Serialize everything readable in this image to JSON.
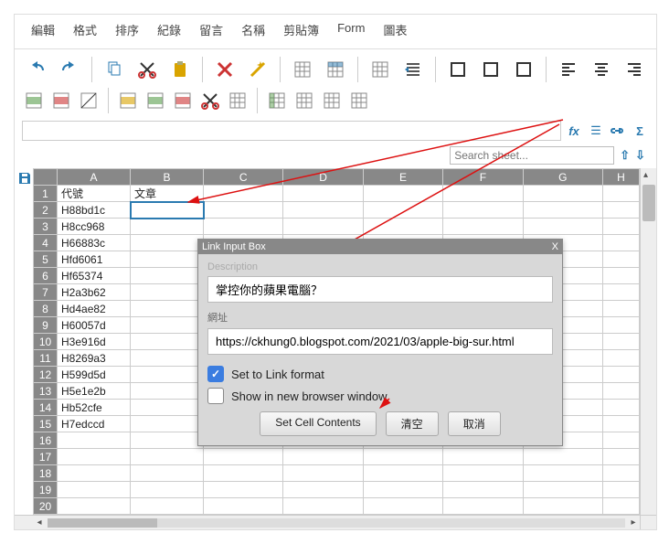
{
  "menubar": [
    "編輯",
    "格式",
    "排序",
    "紀錄",
    "留言",
    "名稱",
    "剪貼簿",
    "Form",
    "圖表"
  ],
  "toolbar": {
    "row1_icons": [
      "undo",
      "redo",
      "sep",
      "copy",
      "cut",
      "paste",
      "sep",
      "delete",
      "magic",
      "sep",
      "grid-a",
      "grid-b",
      "sep",
      "grid-c",
      "indent",
      "sep",
      "border-a",
      "border-b",
      "border-c",
      "sep",
      "align-l",
      "align-c",
      "align-r"
    ],
    "row2_icons": [
      "insert-row",
      "delete-row",
      "diag",
      "sep",
      "fill-a",
      "insert-col",
      "delete-col",
      "cut2",
      "table-a",
      "sep",
      "table-b",
      "table-c",
      "merge",
      "cell"
    ]
  },
  "formula_bar": {
    "value": "",
    "fx": "fx",
    "icons": [
      "sheet",
      "link",
      "sum"
    ]
  },
  "search": {
    "placeholder": "Search sheet...",
    "up": "⇧",
    "down": "⇩"
  },
  "columns": [
    "A",
    "B",
    "C",
    "D",
    "E",
    "F",
    "G",
    "H"
  ],
  "rows": [
    {
      "n": "1",
      "A": "代號",
      "B": "文章"
    },
    {
      "n": "2",
      "A": "H88bd1c",
      "B": "",
      "sel": "B"
    },
    {
      "n": "3",
      "A": "H8cc968"
    },
    {
      "n": "4",
      "A": "H66883c"
    },
    {
      "n": "5",
      "A": "Hfd6061"
    },
    {
      "n": "6",
      "A": "Hf65374"
    },
    {
      "n": "7",
      "A": "H2a3b62"
    },
    {
      "n": "8",
      "A": "Hd4ae82"
    },
    {
      "n": "9",
      "A": "H60057d"
    },
    {
      "n": "10",
      "A": "H3e916d"
    },
    {
      "n": "11",
      "A": "H8269a3"
    },
    {
      "n": "12",
      "A": "H599d5d"
    },
    {
      "n": "13",
      "A": "H5e1e2b"
    },
    {
      "n": "14",
      "A": "Hb52cfe"
    },
    {
      "n": "15",
      "A": "H7edccd"
    },
    {
      "n": "16"
    },
    {
      "n": "17"
    },
    {
      "n": "18"
    },
    {
      "n": "19"
    },
    {
      "n": "20"
    }
  ],
  "dialog": {
    "title": "Link Input Box",
    "close": "X",
    "desc_label": "Description",
    "desc_value": "掌控你的蘋果電腦？",
    "url_label": "網址",
    "url_value": "https://ckhung0.blogspot.com/2021/03/apple-big-sur.html",
    "chk1": {
      "label": "Set to Link format",
      "checked": true
    },
    "chk2": {
      "label": "Show in new browser window",
      "checked": false
    },
    "btn_set": "Set Cell Contents",
    "btn_clear": "清空",
    "btn_cancel": "取消"
  }
}
